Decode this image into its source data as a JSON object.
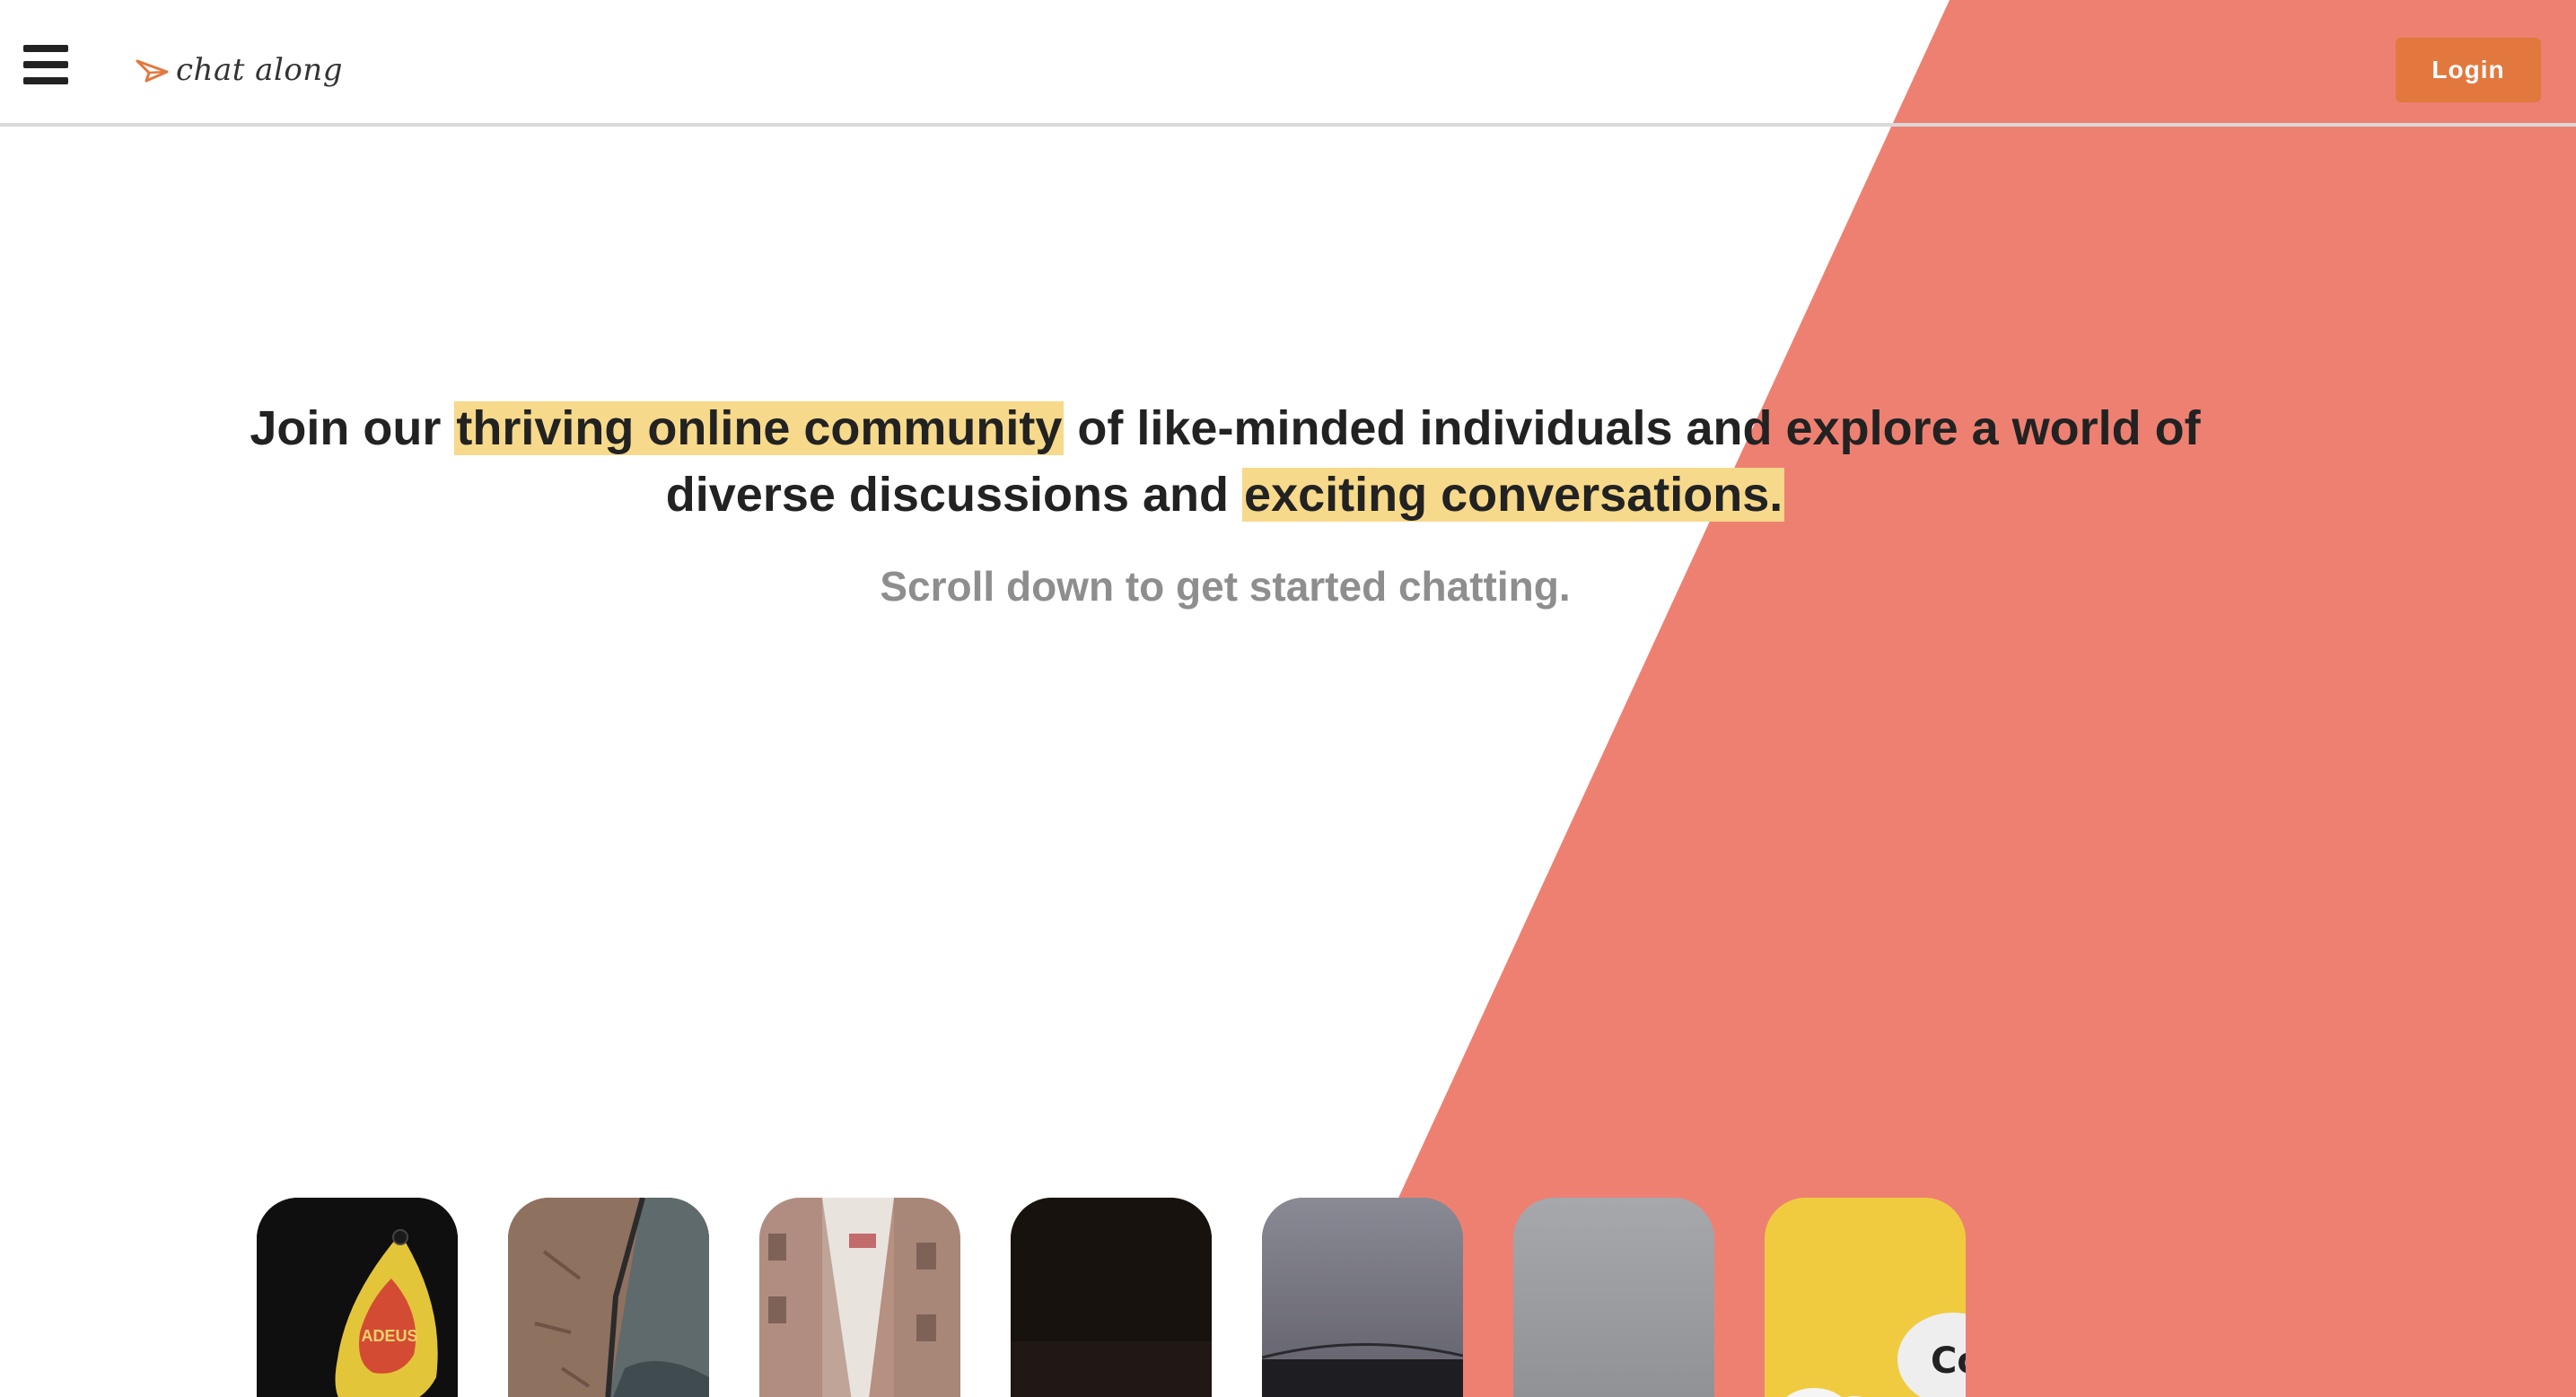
{
  "header": {
    "menu_icon": "hamburger-menu-icon",
    "logo_text": "chat along",
    "logo_icon": "paper-plane-icon",
    "login_label": "Login"
  },
  "hero": {
    "title_parts": [
      {
        "text": "Join our ",
        "highlight": false
      },
      {
        "text": "thriving online community",
        "highlight": true
      },
      {
        "text": " of like-minded individuals and explore a world of diverse discussions and ",
        "highlight": false
      },
      {
        "text": "exciting conversations.",
        "highlight": true
      }
    ],
    "subtitle": "Scroll down to get started chatting."
  },
  "cards": [
    {
      "name": "card-dark-sign"
    },
    {
      "name": "card-rock"
    },
    {
      "name": "card-street"
    },
    {
      "name": "card-dark"
    },
    {
      "name": "card-stormy-sky"
    },
    {
      "name": "card-gray"
    },
    {
      "name": "card-yellow-bubble"
    }
  ],
  "colors": {
    "accent": "#ee8072",
    "button": "#e2783e",
    "highlight": "#f6d98a",
    "text": "#222222",
    "subtext": "#8e8e8e"
  }
}
